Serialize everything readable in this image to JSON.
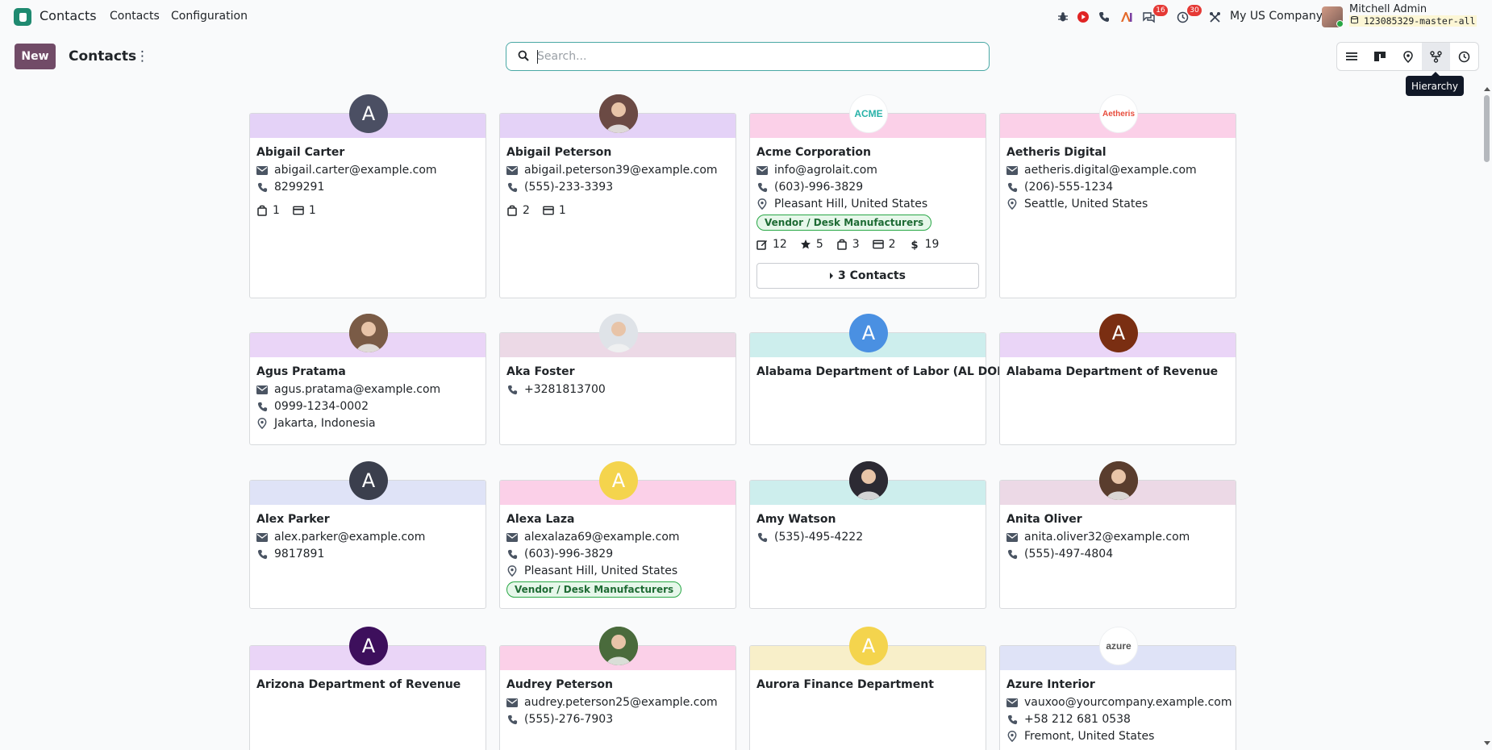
{
  "navbar": {
    "app_name": "Contacts",
    "menu": [
      "Contacts",
      "Configuration"
    ],
    "messages_badge": "16",
    "activities_badge": "30",
    "company": "My US Company",
    "user_name": "Mitchell Admin",
    "db_name": "123085329-master-all"
  },
  "control": {
    "new_label": "New",
    "title": "Contacts",
    "search_placeholder": "Search...",
    "tooltip": "Hierarchy",
    "views": [
      "list-view-icon",
      "kanban-view-icon",
      "map-view-icon",
      "hierarchy-view-icon",
      "activity-view-icon"
    ]
  },
  "colors": {
    "brand": "#714b67",
    "app_logo": "#1f8a70",
    "tag_border": "#28a745"
  },
  "cards": [
    {
      "name": "Abigail Carter",
      "band": "#e4d2f7",
      "avatar": {
        "type": "letter",
        "letter": "A",
        "bg": "#4b4f63"
      },
      "email": "abigail.carter@example.com",
      "phone": "8299291",
      "stats": [
        {
          "icon": "sales-bag-icon",
          "value": "1"
        },
        {
          "icon": "card-icon",
          "value": "1"
        }
      ]
    },
    {
      "name": "Abigail Peterson",
      "band": "#e4d2f7",
      "avatar": {
        "type": "photo",
        "bg": "#6b4a44"
      },
      "email": "abigail.peterson39@example.com",
      "phone": "(555)-233-3393",
      "stats": [
        {
          "icon": "sales-bag-icon",
          "value": "2"
        },
        {
          "icon": "card-icon",
          "value": "1"
        }
      ]
    },
    {
      "name": "Acme Corporation",
      "band": "#fbd0e8",
      "avatar": {
        "type": "logo",
        "text": "ACME",
        "bg": "#ffffff",
        "color": "#28b2a8"
      },
      "email": "info@agrolait.com",
      "phone": "(603)-996-3829",
      "location": "Pleasant Hill, United States",
      "tag": "Vendor / Desk Manufacturers",
      "stats": [
        {
          "icon": "edit-icon",
          "value": "12"
        },
        {
          "icon": "star-icon",
          "value": "5"
        },
        {
          "icon": "sales-bag-icon",
          "value": "3"
        },
        {
          "icon": "card-icon",
          "value": "2"
        },
        {
          "icon": "dollar-icon",
          "value": "19"
        }
      ],
      "contacts_button": "3 Contacts"
    },
    {
      "name": "Aetheris Digital",
      "band": "#fbd0e8",
      "avatar": {
        "type": "logo",
        "text": "Aetheris",
        "bg": "#ffffff",
        "color": "#e74c3c"
      },
      "email": "aetheris.digital@example.com",
      "phone": "(206)-555-1234",
      "location": "Seattle, United States"
    },
    {
      "name": "Agus Pratama",
      "band": "#ead5f7",
      "avatar": {
        "type": "photo",
        "bg": "#7a5b46"
      },
      "email": "agus.pratama@example.com",
      "phone": "0999-1234-0002",
      "location": "Jakarta, Indonesia"
    },
    {
      "name": "Aka Foster",
      "band": "#ecd9e6",
      "avatar": {
        "type": "photo",
        "bg": "#dfe3e8"
      },
      "phone": "+3281813700"
    },
    {
      "name": "Alabama Department of Labor (AL DOL)",
      "band": "#cdeeed",
      "avatar": {
        "type": "letter",
        "letter": "A",
        "bg": "#4a90e2"
      }
    },
    {
      "name": "Alabama Department of Revenue",
      "band": "#ead5f7",
      "avatar": {
        "type": "letter",
        "letter": "A",
        "bg": "#7a2e12"
      }
    },
    {
      "name": "Alex Parker",
      "band": "#dfe3f7",
      "avatar": {
        "type": "letter",
        "letter": "A",
        "bg": "#3b3f4d"
      },
      "email": "alex.parker@example.com",
      "phone": "9817891"
    },
    {
      "name": "Alexa Laza",
      "band": "#fbd0e8",
      "avatar": {
        "type": "letter",
        "letter": "A",
        "bg": "#f4d44d"
      },
      "email": "alexalaza69@example.com",
      "phone": "(603)-996-3829",
      "location": "Pleasant Hill, United States",
      "tag": "Vendor / Desk Manufacturers"
    },
    {
      "name": "Amy Watson",
      "band": "#cdeeed",
      "avatar": {
        "type": "photo",
        "bg": "#2c2a33"
      },
      "phone": "(535)-495-4222"
    },
    {
      "name": "Anita Oliver",
      "band": "#ecd9e6",
      "avatar": {
        "type": "photo",
        "bg": "#5a3d2e"
      },
      "email": "anita.oliver32@example.com",
      "phone": "(555)-497-4804"
    },
    {
      "name": "Arizona Department of Revenue",
      "band": "#ead5f7",
      "avatar": {
        "type": "letter",
        "letter": "A",
        "bg": "#3d0f5c"
      }
    },
    {
      "name": "Audrey Peterson",
      "band": "#fbd0e8",
      "avatar": {
        "type": "photo",
        "bg": "#4a6b3c"
      },
      "email": "audrey.peterson25@example.com",
      "phone": "(555)-276-7903"
    },
    {
      "name": "Aurora Finance Department",
      "band": "#f8efc9",
      "avatar": {
        "type": "letter",
        "letter": "A",
        "bg": "#f4d44d"
      }
    },
    {
      "name": "Azure Interior",
      "band": "#dfe3f7",
      "avatar": {
        "type": "logo",
        "text": "azure",
        "bg": "#ffffff",
        "color": "#555555"
      },
      "email": "vauxoo@yourcompany.example.com",
      "phone": "+58 212 681 0538",
      "location": "Fremont, United States"
    }
  ]
}
